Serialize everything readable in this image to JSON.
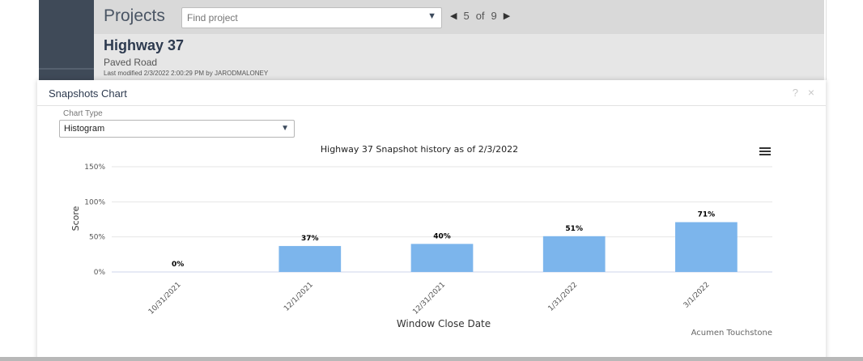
{
  "header": {
    "projects_title": "Projects",
    "find_placeholder": "Find project",
    "pager": {
      "current": "5",
      "of_label": "of",
      "total": "9"
    }
  },
  "project": {
    "name": "Highway 37",
    "subtitle": "Paved Road",
    "modified": "Last modified 2/3/2022 2:00:29 PM by JARODMALONEY"
  },
  "panel": {
    "title": "Snapshots Chart",
    "help": "?",
    "close": "×",
    "chart_type_label": "Chart Type",
    "chart_type_value": "Histogram"
  },
  "colors": {
    "bar": "#7cb5ec",
    "grid": "#e6e6e6",
    "axis": "#ccd6eb"
  },
  "chart_data": {
    "type": "bar",
    "title": "Highway 37 Snapshot history as of 2/3/2022",
    "xlabel": "Window Close Date",
    "ylabel": "Score",
    "credits": "Acumen Touchstone",
    "categories": [
      "10/31/2021",
      "12/1/2021",
      "12/31/2021",
      "1/31/2022",
      "3/1/2022"
    ],
    "values": [
      0,
      37,
      40,
      51,
      71
    ],
    "data_labels": [
      "0%",
      "37%",
      "40%",
      "51%",
      "71%"
    ],
    "y_ticks": [
      0,
      50,
      100,
      150
    ],
    "y_tick_labels": [
      "0%",
      "50%",
      "100%",
      "150%"
    ],
    "ylim": [
      0,
      150
    ],
    "grid": true,
    "legend": "none"
  }
}
